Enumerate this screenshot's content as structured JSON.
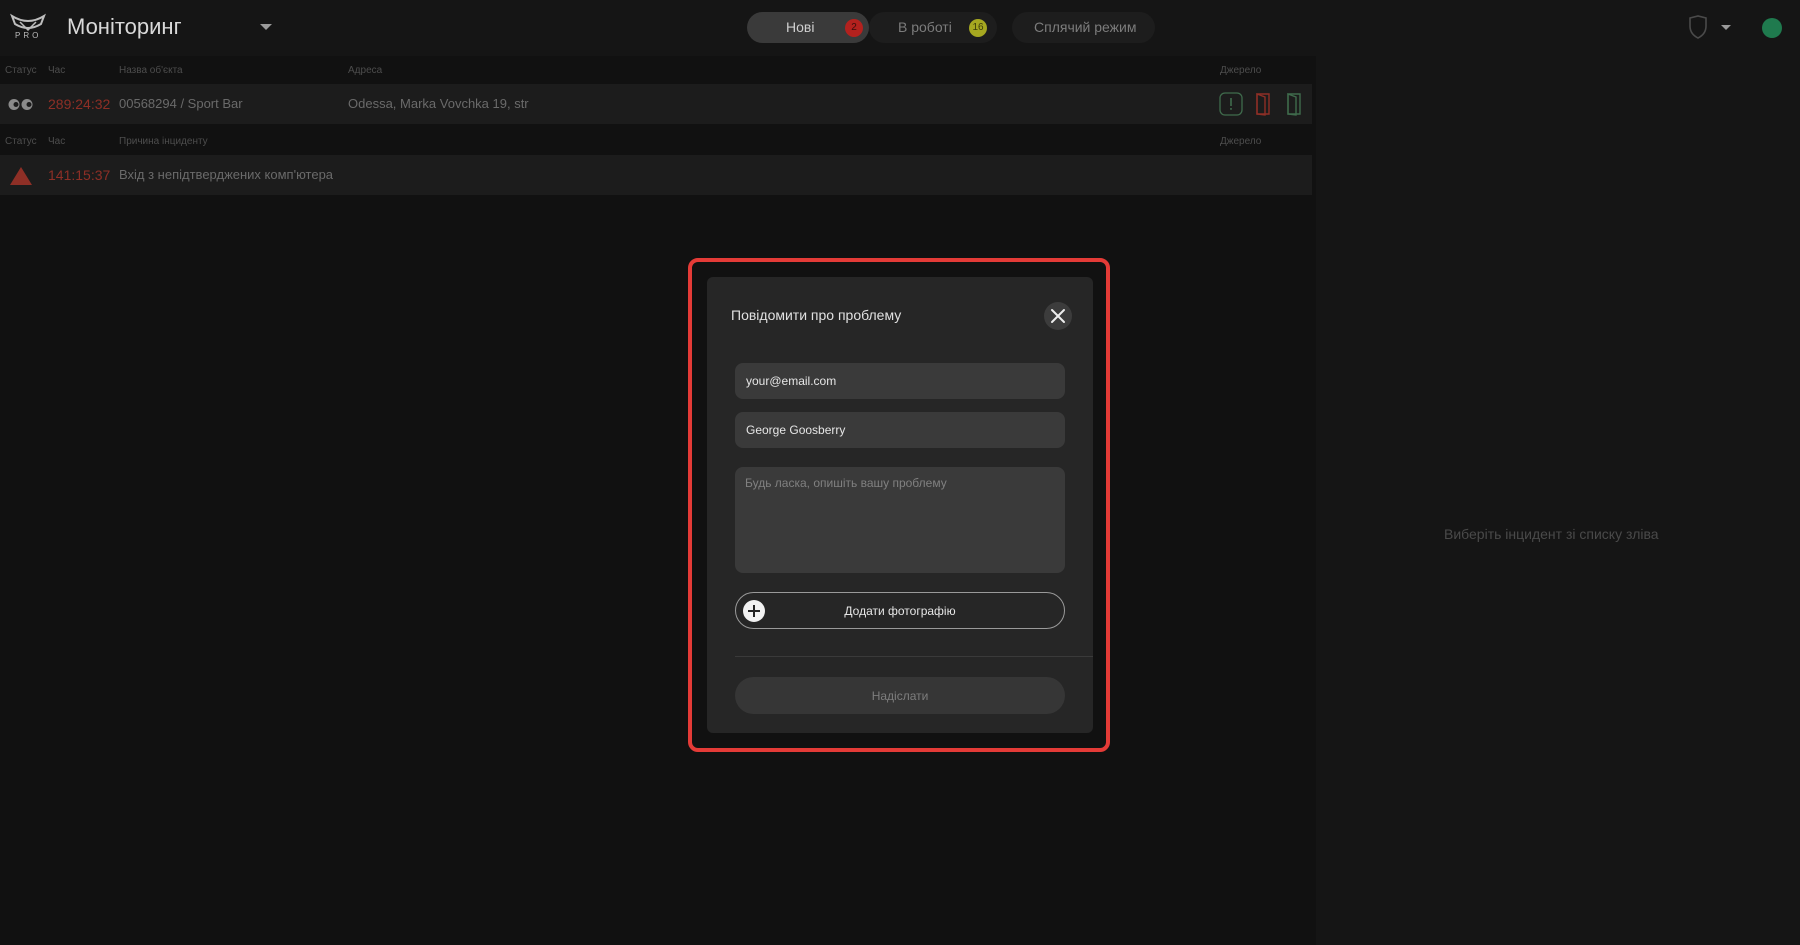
{
  "header": {
    "logo_text": "PRO",
    "title": "Моніторинг",
    "tabs": [
      {
        "label": "Нові",
        "badge": "2",
        "active": true,
        "badge_color": "#b3211e"
      },
      {
        "label": "В роботі",
        "badge": "16",
        "active": false,
        "badge_color": "#a6a820"
      },
      {
        "label": "Сплячий режим",
        "active": false
      }
    ],
    "user_status_color": "#1f7a4e"
  },
  "incidents_table": {
    "columns": {
      "status": "Статус",
      "time": "Час",
      "object_name": "Назва об'єкта",
      "address": "Адреса",
      "source": "Джерело"
    },
    "rows": [
      {
        "time": "289:24:32",
        "object_name": "00568294 / Sport Bar",
        "address": "Odessa, Marka Vovchka 19, str"
      }
    ]
  },
  "events_table": {
    "columns": {
      "status": "Статус",
      "time": "Час",
      "reason": "Причина інциденту",
      "source": "Джерело"
    },
    "rows": [
      {
        "time": "141:15:37",
        "reason": "Вхід з непідтверджених комп'ютера",
        "status_icon": "warning-triangle-icon"
      }
    ]
  },
  "right_panel": {
    "hint": "Виберіть інцидент зі списку зліва"
  },
  "modal": {
    "title": "Повідомити про проблему",
    "email_value": "your@email.com",
    "name_value": "George Goosberry",
    "description_placeholder": "Будь ласка, опишіть вашу проблему",
    "add_photo_label": "Додати фотографію",
    "submit_label": "Надіслати",
    "highlight_color": "#e43b37"
  }
}
